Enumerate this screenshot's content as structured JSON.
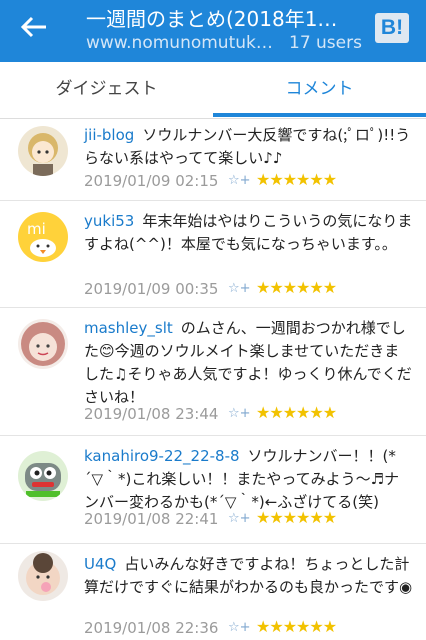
{
  "header": {
    "title": "一週間のまとめ(2018年1…",
    "url": "www.nomunomutuk…",
    "users": "17 users",
    "b_button": "B!"
  },
  "tabs": [
    {
      "label": "ダイジェスト",
      "selected": false
    },
    {
      "label": "コメント",
      "selected": true
    }
  ],
  "comments": [
    {
      "user": "jii-blog",
      "text": "ソウルナンバー大反響ですね(;ﾟロﾟ)!!うらない系はやってて楽しい♪♪",
      "date": "2019/01/09 02:15",
      "stars": "★★★★★★"
    },
    {
      "user": "yuki53",
      "text": "年末年始はやはりこういうの気になりますよね(^^)！本屋でも気になっちゃいます。。",
      "date": "2019/01/09 00:35",
      "stars": "★★★★★★"
    },
    {
      "user": "mashley_slt",
      "text": "のムさん、一週間おつかれ様でした😊今週のソウルメイト楽しませていただきました♫そりゃあ人気ですよ！ゆっくり休んでくださいね！",
      "date": "2019/01/08 23:44",
      "stars": "★★★★★★"
    },
    {
      "user": "kanahiro9-22_22-8-8",
      "text": "ソウルナンバー！！(*´▽｀*)これ楽しい！！またやってみよう～♬ナンバー変わるかも(*´▽｀*)←ふざけてる(笑)",
      "date": "2019/01/08 22:41",
      "stars": "★★★★★★"
    },
    {
      "user": "U4Q",
      "text": "占いみんな好きですよね！ちょっとした計算だけですぐに結果がわかるのも良かったです◉",
      "date": "2019/01/08 22:36",
      "stars": "★★★★★★"
    }
  ],
  "icons": {
    "add_star": "☆+"
  },
  "colors": {
    "header_bg": "#1f86d9",
    "link": "#1a7bcb",
    "star": "#f2c200"
  }
}
